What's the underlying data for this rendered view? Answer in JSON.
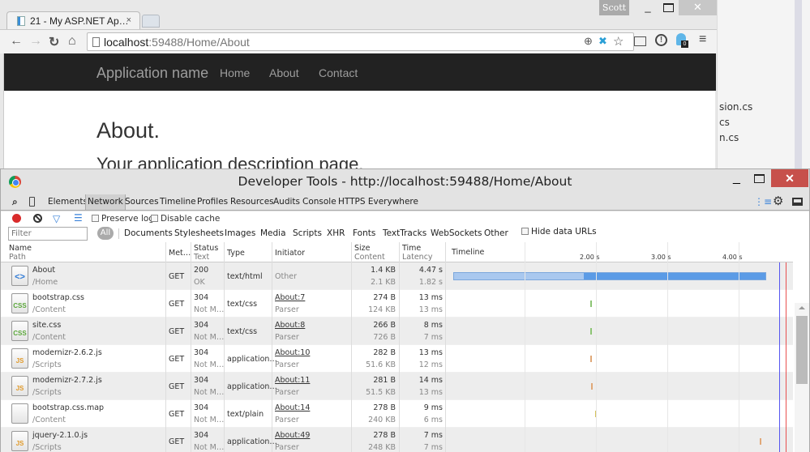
{
  "browser": {
    "tab_title": "21 - My ASP.NET Ap…",
    "tab_close": "×",
    "user": "Scott",
    "url_host": "localhost",
    "url_rest": ":59488/Home/About",
    "nav_icons": {
      "back": "←",
      "forward": "→",
      "reload": "↻",
      "home": "⌂"
    },
    "window_controls": {
      "minimize": "_",
      "close": "✕"
    }
  },
  "page": {
    "brand": "Application name",
    "nav": [
      "Home",
      "About",
      "Contact"
    ],
    "heading": "About.",
    "description": "Your application description page."
  },
  "background_window": {
    "files": [
      "sion.cs",
      "cs",
      "n.cs"
    ]
  },
  "devtools": {
    "title": "Developer Tools - http://localhost:59488/Home/About",
    "close": "✕",
    "minimize": "_",
    "tabs": [
      "Elements",
      "Network",
      "Sources",
      "Timeline",
      "Profiles",
      "Resources",
      "Audits",
      "Console",
      "HTTPS Everywhere"
    ],
    "active_tab": "Network",
    "controls": {
      "preserve_log": "Preserve log",
      "disable_cache": "Disable cache",
      "preserve_log_checked": false,
      "disable_cache_checked": false
    },
    "filter": {
      "placeholder": "Filter",
      "all": "All",
      "types": [
        "Documents",
        "Stylesheets",
        "Images",
        "Media",
        "Scripts",
        "XHR",
        "Fonts",
        "TextTracks",
        "WebSockets",
        "Other"
      ],
      "hide_data_urls": "Hide data URLs"
    },
    "columns": {
      "name": "Name",
      "path": "Path",
      "method": "Met…",
      "status": "Status",
      "status_text": "Text",
      "type": "Type",
      "initiator": "Initiator",
      "size": "Size",
      "content": "Content",
      "time": "Time",
      "latency": "Latency",
      "timeline": "Timeline"
    },
    "timeline_ticks": [
      "2.00 s",
      "3.00 s",
      "4.00 s"
    ],
    "colors": {
      "css_bar": "#8cc474",
      "js_bar": "#e0a878",
      "map_bar": "#d4c25a",
      "doc_bar": "#5b9be6",
      "dom_line": "#5656f0",
      "load_line": "#e85050",
      "record": "#d92b2b",
      "accent": "#3a82d9"
    },
    "requests": [
      {
        "name": "About",
        "path": "/Home",
        "method": "GET",
        "status": "200",
        "status_text": "OK",
        "type": "text/html",
        "initiator": "Other",
        "initiator_link": false,
        "initiator_sub": "",
        "size": "1.4 KB",
        "content": "2.1 KB",
        "time": "4.47 s",
        "latency": "1.82 s",
        "icon": "html",
        "icon_label": "<>"
      },
      {
        "name": "bootstrap.css",
        "path": "/Content",
        "method": "GET",
        "status": "304",
        "status_text": "Not M…",
        "type": "text/css",
        "initiator": "About:7",
        "initiator_link": true,
        "initiator_sub": "Parser",
        "size": "274 B",
        "content": "124 KB",
        "time": "13 ms",
        "latency": "13 ms",
        "icon": "css",
        "icon_label": "CSS"
      },
      {
        "name": "site.css",
        "path": "/Content",
        "method": "GET",
        "status": "304",
        "status_text": "Not M…",
        "type": "text/css",
        "initiator": "About:8",
        "initiator_link": true,
        "initiator_sub": "Parser",
        "size": "266 B",
        "content": "726 B",
        "time": "8 ms",
        "latency": "7 ms",
        "icon": "css",
        "icon_label": "CSS"
      },
      {
        "name": "modernizr-2.6.2.js",
        "path": "/Scripts",
        "method": "GET",
        "status": "304",
        "status_text": "Not M…",
        "type": "application…",
        "initiator": "About:10",
        "initiator_link": true,
        "initiator_sub": "Parser",
        "size": "282 B",
        "content": "51.6 KB",
        "time": "13 ms",
        "latency": "12 ms",
        "icon": "js",
        "icon_label": "JS"
      },
      {
        "name": "modernizr-2.7.2.js",
        "path": "/Scripts",
        "method": "GET",
        "status": "304",
        "status_text": "Not M…",
        "type": "application…",
        "initiator": "About:11",
        "initiator_link": true,
        "initiator_sub": "Parser",
        "size": "281 B",
        "content": "51.5 KB",
        "time": "14 ms",
        "latency": "13 ms",
        "icon": "js",
        "icon_label": "JS"
      },
      {
        "name": "bootstrap.css.map",
        "path": "/Content",
        "method": "GET",
        "status": "304",
        "status_text": "Not M…",
        "type": "text/plain",
        "initiator": "About:14",
        "initiator_link": true,
        "initiator_sub": "Parser",
        "size": "278 B",
        "content": "240 KB",
        "time": "9 ms",
        "latency": "6 ms",
        "icon": "blank",
        "icon_label": ""
      },
      {
        "name": "jquery-2.1.0.js",
        "path": "/Scripts",
        "method": "GET",
        "status": "304",
        "status_text": "Not M…",
        "type": "application…",
        "initiator": "About:49",
        "initiator_link": true,
        "initiator_sub": "Parser",
        "size": "278 B",
        "content": "248 KB",
        "time": "7 ms",
        "latency": "7 ms",
        "icon": "js",
        "icon_label": "JS"
      }
    ]
  }
}
